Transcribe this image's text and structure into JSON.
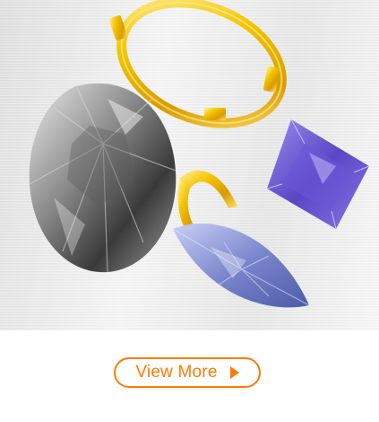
{
  "promo": {
    "cta_label": "View More",
    "cta_icon": "play-arrow-icon",
    "accent_color": "#ff7a00"
  }
}
